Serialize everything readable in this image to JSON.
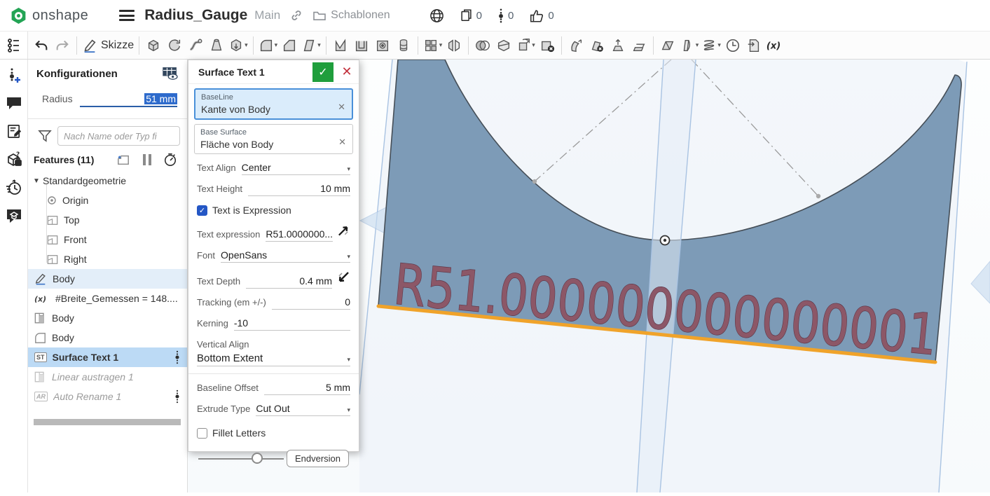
{
  "titlebar": {
    "brand": "onshape",
    "doc_title": "Radius_Gauge",
    "workspace": "Main",
    "folder": "Schablonen",
    "copies_count": "0",
    "versions_count": "0",
    "likes_count": "0"
  },
  "toolbar": {
    "sketch_label": "Skizze",
    "icons": [
      "feature-list",
      "undo",
      "redo",
      "sketch",
      "extrude",
      "revolve",
      "sweep",
      "loft",
      "thicken",
      "fillet",
      "chamfer",
      "draft",
      "rib",
      "shell",
      "hole",
      "linear-pattern",
      "pattern",
      "mirror",
      "boolean",
      "split",
      "transform",
      "delete-part",
      "move-face",
      "delete-face",
      "extract-face",
      "replace-face",
      "plane",
      "enclose",
      "helix",
      "measure-clock",
      "import",
      "variable"
    ]
  },
  "left_rail": {
    "icons": [
      "create-version",
      "comments",
      "edit-notes",
      "permissions-cube",
      "history",
      "learning-center"
    ]
  },
  "panel": {
    "title": "Konfigurationen",
    "radius_label": "Radius",
    "radius_value": "51 mm",
    "filter_placeholder": "Nach Name oder Typ fi",
    "features_label": "Features (11)",
    "tree": {
      "items": [
        {
          "label": "Standardgeometrie"
        },
        {
          "label": "Origin"
        },
        {
          "label": "Top"
        },
        {
          "label": "Front"
        },
        {
          "label": "Right"
        },
        {
          "label": "Body"
        },
        {
          "label": "#Breite_Gemessen = 148...."
        },
        {
          "label": "Body"
        },
        {
          "label": "Body"
        },
        {
          "label": "Surface Text 1",
          "badge": "ST"
        },
        {
          "label": "Linear austragen 1"
        },
        {
          "label": "Auto Rename 1",
          "badge": "AR"
        }
      ]
    }
  },
  "dialog": {
    "title": "Surface Text 1",
    "baseline_label": "BaseLine",
    "baseline_value": "Kante von Body",
    "base_surface_label": "Base Surface",
    "base_surface_value": "Fläche von Body",
    "text_align_label": "Text Align",
    "text_align_value": "Center",
    "text_height_label": "Text Height",
    "text_height_value": "10 mm",
    "text_is_expression_label": "Text is Expression",
    "text_expression_label": "Text expression",
    "text_expression_value": "R51.0000000...",
    "font_label": "Font",
    "font_value": "OpenSans",
    "text_depth_label": "Text Depth",
    "text_depth_value": "0.4 mm",
    "tracking_label": "Tracking (em +/-)",
    "tracking_value": "0",
    "kerning_label": "Kerning",
    "kerning_value": "-10",
    "vertical_align_label": "Vertical Align",
    "vertical_align_value": "Bottom Extent",
    "baseline_offset_label": "Baseline Offset",
    "baseline_offset_value": "5 mm",
    "extrude_type_label": "Extrude Type",
    "extrude_type_value": "Cut Out",
    "fillet_letters_label": "Fillet Letters",
    "endversion_label": "Endversion"
  },
  "canvas": {
    "engraved_text": "R51.000000000000001",
    "colors": {
      "plate": "#7d9bb7",
      "plate_outline": "#454e57",
      "edge_highlight": "#f0a32a",
      "engraved_text": "#8c5767",
      "plane_edge": "#a9c3e2"
    }
  }
}
